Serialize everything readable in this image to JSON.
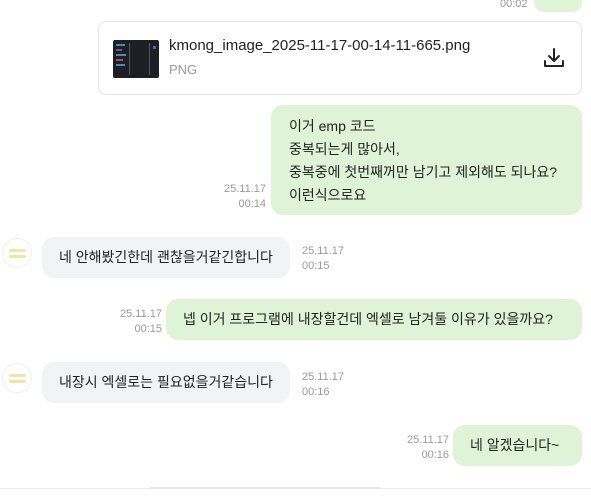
{
  "top_message": {
    "time": "00:02"
  },
  "file": {
    "name": "kmong_image_2025-11-17-00-14-11-665.png",
    "type": "PNG",
    "thumbnail_icon": "image-thumbnail",
    "download_icon": "download-icon"
  },
  "messages": [
    {
      "sender": "me",
      "lines": [
        "이거 emp 코드",
        "중복되는게 많아서,",
        "중복중에 첫번째꺼만 남기고 제외해도 되나요?",
        "이런식으로요"
      ],
      "date": "25.11.17",
      "time": "00:14"
    },
    {
      "sender": "them",
      "text": "네 안해봤긴한데 괜찮을거같긴합니다",
      "date": "25.11.17",
      "time": "00:15"
    },
    {
      "sender": "me",
      "text": "넵 이거 프로그램에 내장할건데 엑셀로 남겨둘 이유가 있을까요?",
      "date": "25.11.17",
      "time": "00:15"
    },
    {
      "sender": "them",
      "text": "내장시 엑셀로는 필요없을거같습니다",
      "date": "25.11.17",
      "time": "00:16"
    },
    {
      "sender": "me",
      "text": "네 알겠습니다~",
      "date": "25.11.17",
      "time": "00:16"
    }
  ],
  "colors": {
    "my_bubble": "#dff4d6",
    "their_bubble": "#f2f3f5",
    "timestamp": "#9a9a9a"
  }
}
